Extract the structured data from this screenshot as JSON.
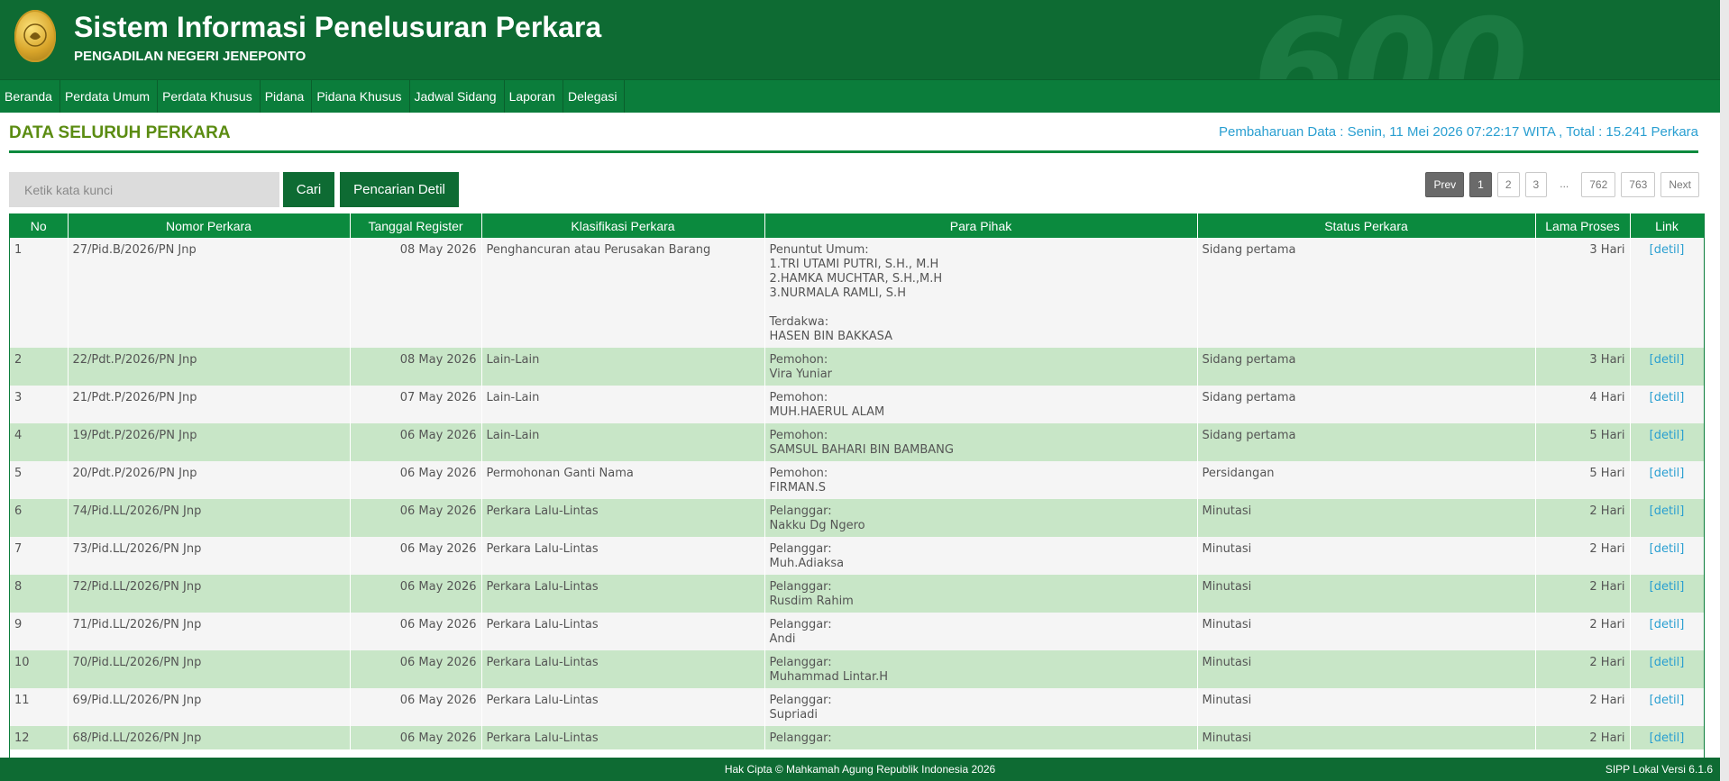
{
  "header": {
    "title": "Sistem Informasi Penelusuran Perkara",
    "subtitle": "PENGADILAN NEGERI JENEPONTO",
    "bg_text": "600"
  },
  "nav": [
    "Beranda",
    "Perdata Umum",
    "Perdata Khusus",
    "Pidana",
    "Pidana Khusus",
    "Jadwal Sidang",
    "Laporan",
    "Delegasi"
  ],
  "page": {
    "heading": "DATA SELURUH PERKARA",
    "update": "Pembaharuan Data : Senin, 11 Mei 2026 07:22:17 WITA , Total : 15.241 Perkara"
  },
  "search": {
    "placeholder": "Ketik kata kunci",
    "cari": "Cari",
    "detil": "Pencarian Detil"
  },
  "pagination": {
    "prev": "Prev",
    "p1": "1",
    "p2": "2",
    "p3": "3",
    "ellipsis": "...",
    "p762": "762",
    "p763": "763",
    "next": "Next"
  },
  "table": {
    "headers": {
      "no": "No",
      "nomor": "Nomor Perkara",
      "tanggal": "Tanggal Register",
      "klasifikasi": "Klasifikasi Perkara",
      "pihak": "Para Pihak",
      "status": "Status Perkara",
      "lama": "Lama Proses",
      "link": "Link"
    },
    "rows": [
      {
        "no": "1",
        "nomor": "27/Pid.B/2026/PN Jnp",
        "tanggal": "08 May 2026",
        "klasifikasi": "Penghancuran atau Perusakan Barang",
        "pihak": "Penuntut Umum:\n1.TRI UTAMI PUTRI, S.H., M.H\n2.HAMKA MUCHTAR, S.H.,M.H\n3.NURMALA RAMLI, S.H\n\nTerdakwa:\nHASEN BIN BAKKASA",
        "status": "Sidang pertama",
        "lama": "3 Hari",
        "link": "[detil]"
      },
      {
        "no": "2",
        "nomor": "22/Pdt.P/2026/PN Jnp",
        "tanggal": "08 May 2026",
        "klasifikasi": "Lain-Lain",
        "pihak": "Pemohon:\nVira Yuniar",
        "status": "Sidang pertama",
        "lama": "3 Hari",
        "link": "[detil]"
      },
      {
        "no": "3",
        "nomor": "21/Pdt.P/2026/PN Jnp",
        "tanggal": "07 May 2026",
        "klasifikasi": "Lain-Lain",
        "pihak": "Pemohon:\nMUH.HAERUL ALAM",
        "status": "Sidang pertama",
        "lama": "4 Hari",
        "link": "[detil]"
      },
      {
        "no": "4",
        "nomor": "19/Pdt.P/2026/PN Jnp",
        "tanggal": "06 May 2026",
        "klasifikasi": "Lain-Lain",
        "pihak": "Pemohon:\nSAMSUL BAHARI BIN BAMBANG",
        "status": "Sidang pertama",
        "lama": "5 Hari",
        "link": "[detil]"
      },
      {
        "no": "5",
        "nomor": "20/Pdt.P/2026/PN Jnp",
        "tanggal": "06 May 2026",
        "klasifikasi": "Permohonan Ganti Nama",
        "pihak": "Pemohon:\nFIRMAN.S",
        "status": "Persidangan",
        "lama": "5 Hari",
        "link": "[detil]"
      },
      {
        "no": "6",
        "nomor": "74/Pid.LL/2026/PN Jnp",
        "tanggal": "06 May 2026",
        "klasifikasi": "Perkara Lalu-Lintas",
        "pihak": "Pelanggar:\nNakku Dg Ngero",
        "status": "Minutasi",
        "lama": "2 Hari",
        "link": "[detil]"
      },
      {
        "no": "7",
        "nomor": "73/Pid.LL/2026/PN Jnp",
        "tanggal": "06 May 2026",
        "klasifikasi": "Perkara Lalu-Lintas",
        "pihak": "Pelanggar:\nMuh.Adiaksa",
        "status": "Minutasi",
        "lama": "2 Hari",
        "link": "[detil]"
      },
      {
        "no": "8",
        "nomor": "72/Pid.LL/2026/PN Jnp",
        "tanggal": "06 May 2026",
        "klasifikasi": "Perkara Lalu-Lintas",
        "pihak": "Pelanggar:\nRusdim Rahim",
        "status": "Minutasi",
        "lama": "2 Hari",
        "link": "[detil]"
      },
      {
        "no": "9",
        "nomor": "71/Pid.LL/2026/PN Jnp",
        "tanggal": "06 May 2026",
        "klasifikasi": "Perkara Lalu-Lintas",
        "pihak": "Pelanggar:\nAndi",
        "status": "Minutasi",
        "lama": "2 Hari",
        "link": "[detil]"
      },
      {
        "no": "10",
        "nomor": "70/Pid.LL/2026/PN Jnp",
        "tanggal": "06 May 2026",
        "klasifikasi": "Perkara Lalu-Lintas",
        "pihak": "Pelanggar:\nMuhammad Lintar.H",
        "status": "Minutasi",
        "lama": "2 Hari",
        "link": "[detil]"
      },
      {
        "no": "11",
        "nomor": "69/Pid.LL/2026/PN Jnp",
        "tanggal": "06 May 2026",
        "klasifikasi": "Perkara Lalu-Lintas",
        "pihak": "Pelanggar:\nSupriadi",
        "status": "Minutasi",
        "lama": "2 Hari",
        "link": "[detil]"
      },
      {
        "no": "12",
        "nomor": "68/Pid.LL/2026/PN Jnp",
        "tanggal": "06 May 2026",
        "klasifikasi": "Perkara Lalu-Lintas",
        "pihak": "Pelanggar:",
        "status": "Minutasi",
        "lama": "2 Hari",
        "link": "[detil]"
      }
    ]
  },
  "footer": {
    "copyright": "Hak Cipta © Mahkamah Agung Republik Indonesia 2026",
    "version": "SIPP Lokal Versi 6.1.6"
  },
  "colors": {
    "brand_green": "#0e6b33",
    "nav_green": "#0b7d3b",
    "row_green": "#c8e6c7",
    "link_blue": "#2a9fd1",
    "heading_green": "#5b8c12"
  }
}
